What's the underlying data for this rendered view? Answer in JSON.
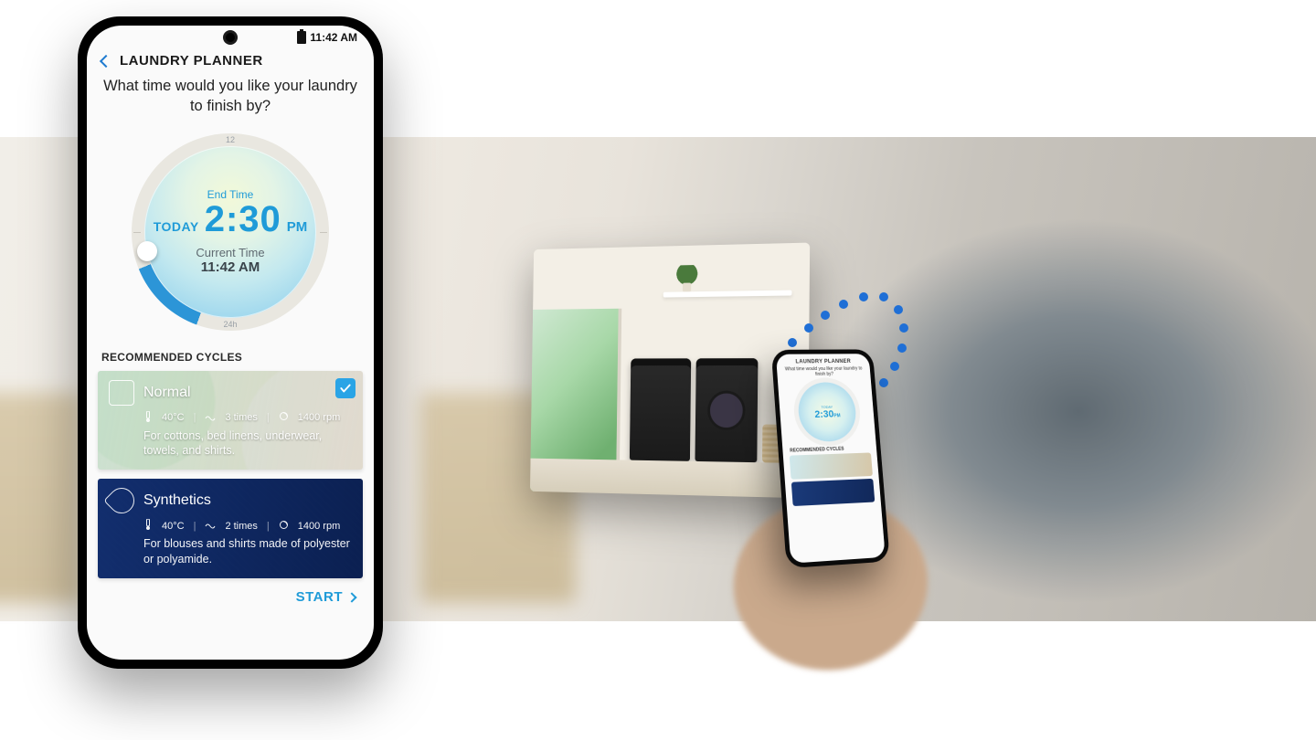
{
  "status": {
    "time": "11:42 AM"
  },
  "header": {
    "title": "LAUNDRY PLANNER",
    "question": "What time would you like your laundry to finish by?"
  },
  "dial": {
    "tick_top": "12",
    "tick_bottom": "24h",
    "end_label": "End Time",
    "end_today": "TODAY",
    "end_time": "2:30",
    "end_period": "PM",
    "current_label": "Current Time",
    "current_time": "11:42 AM"
  },
  "recommended": {
    "title": "RECOMMENDED CYCLES",
    "cycles": [
      {
        "name": "Normal",
        "temp": "40°C",
        "rinses": "3 times",
        "spin": "1400 rpm",
        "desc": "For cottons, bed linens, underwear, towels, and shirts.",
        "selected": true
      },
      {
        "name": "Synthetics",
        "temp": "40°C",
        "rinses": "2 times",
        "spin": "1400 rpm",
        "desc": "For blouses and shirts made of polyester or polyamide.",
        "selected": false
      }
    ]
  },
  "start_label": "START",
  "mini_phone": {
    "title": "LAUNDRY PLANNER",
    "question": "What time would you like your laundry to finish by?",
    "today": "TODAY",
    "time": "2:30",
    "period": "PM",
    "rec": "RECOMMENDED CYCLES"
  }
}
